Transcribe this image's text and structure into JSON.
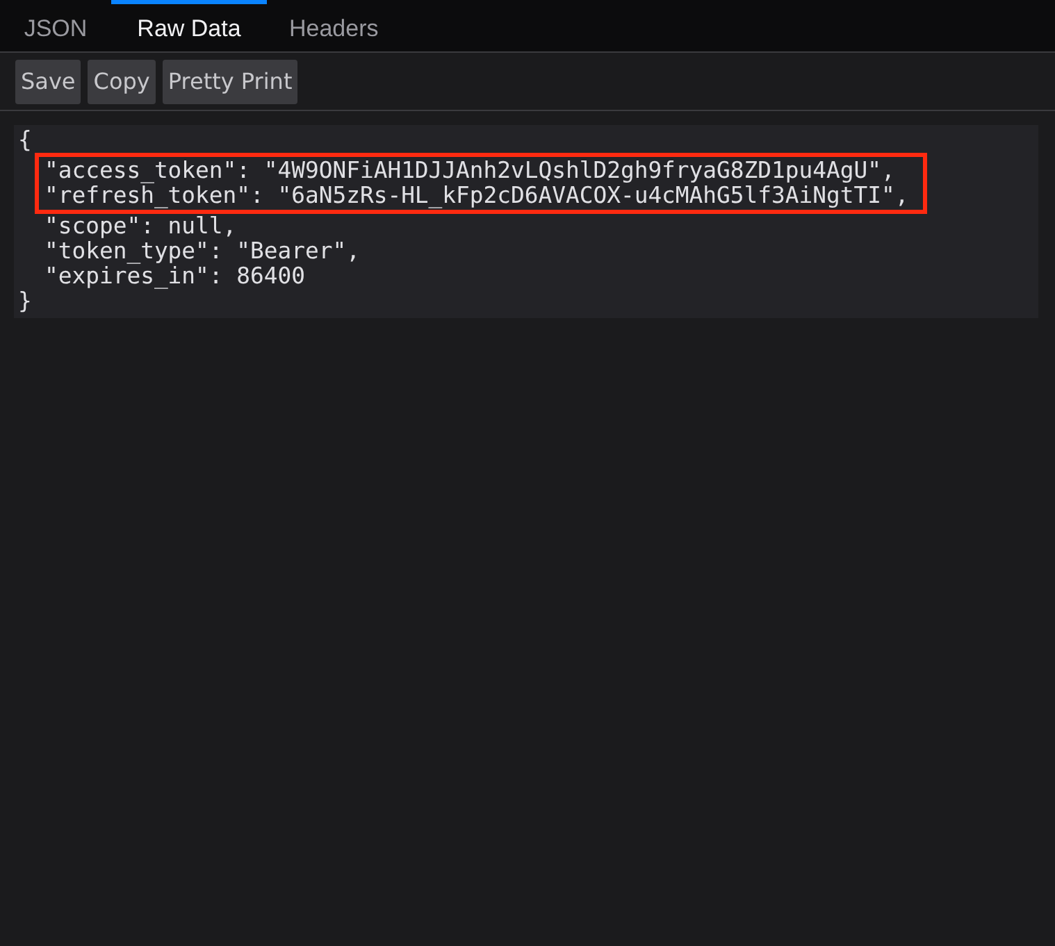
{
  "tabs": [
    {
      "label": "JSON",
      "selected": false
    },
    {
      "label": "Raw Data",
      "selected": true
    },
    {
      "label": "Headers",
      "selected": false
    }
  ],
  "toolbar": {
    "buttons": [
      "Save",
      "Copy",
      "Pretty Print"
    ]
  },
  "raw_data": {
    "lines": [
      {
        "text": "{",
        "highlighted": false
      },
      {
        "text": "\"access_token\": \"4W9ONFiAH1DJJAnh2vLQshlD2gh9fryaG8ZD1pu4AgU\",",
        "highlighted": true
      },
      {
        "text": "\"refresh_token\": \"6aN5zRs-HL_kFp2cD6AVACOX-u4cMAhG5lf3AiNgtTI\",",
        "highlighted": true
      },
      {
        "text": "\"scope\": null,",
        "highlighted": false
      },
      {
        "text": "\"token_type\": \"Bearer\",",
        "highlighted": false
      },
      {
        "text": "\"expires_in\": 86400",
        "highlighted": false
      },
      {
        "text": "}",
        "highlighted": false
      }
    ]
  }
}
